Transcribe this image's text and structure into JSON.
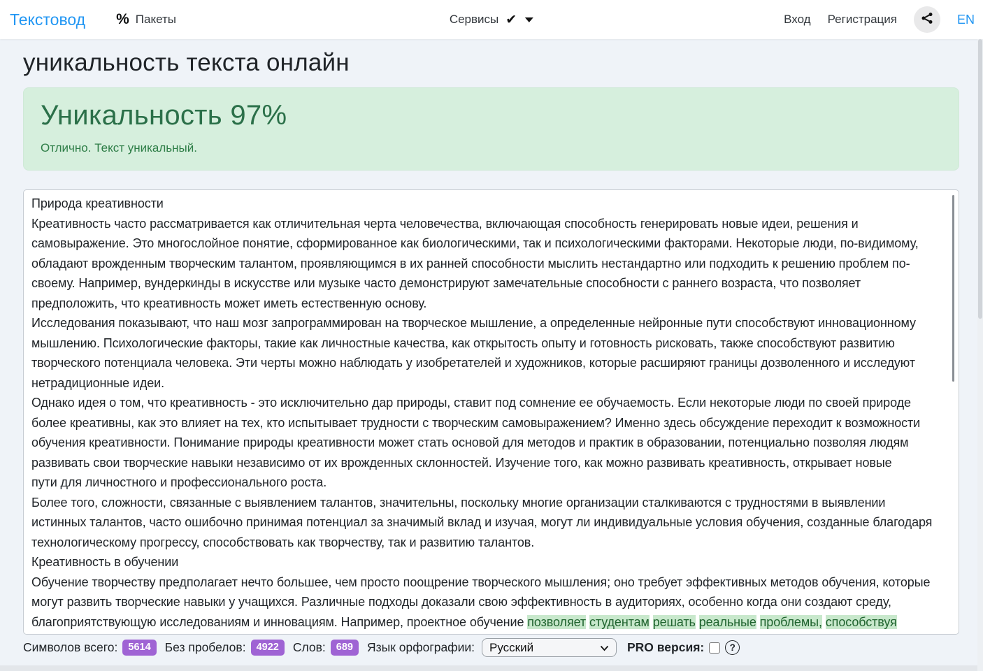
{
  "navbar": {
    "logo": "Текстовод",
    "packages_label": "Пакеты",
    "percent_icon": "%",
    "services_label": "Сервисы",
    "check_icon": "✔",
    "login_label": "Вход",
    "register_label": "Регистрация",
    "lang_label": "EN",
    "accent_color": "#2196f3"
  },
  "page": {
    "title": "уникальность текста онлайн"
  },
  "result": {
    "heading": "Уникальность 97%",
    "subtext": "Отлично. Текст уникальный.",
    "percent": 97,
    "bg_color": "#d6efdd",
    "text_color": "#2b7049"
  },
  "editor": {
    "highlight_bg": "#c8e8cc",
    "lines": [
      [
        {
          "t": "Природа креативности",
          "h": false
        }
      ],
      [
        {
          "t": "Креативность часто рассматривается как отличительная черта человечества, включающая способность генерировать новые идеи, решения и",
          "h": false
        }
      ],
      [
        {
          "t": "самовыражение. Это многослойное понятие, сформированное как биологическими, так и психологическими факторами. Некоторые люди, по-видимому,",
          "h": false
        }
      ],
      [
        {
          "t": "обладают врожденным творческим талантом, проявляющимся в их ранней способности мыслить нестандартно или подходить к решению проблем по-",
          "h": false
        }
      ],
      [
        {
          "t": "своему. Например, вундеркинды в искусстве или музыке часто демонстрируют замечательные способности с раннего возраста, что позволяет",
          "h": false
        }
      ],
      [
        {
          "t": "предположить, что креативность может иметь естественную основу.",
          "h": false
        }
      ],
      [
        {
          "t": "Исследования показывают, что наш мозг запрограммирован на творческое мышление, а определенные нейронные пути способствуют инновационному",
          "h": false
        }
      ],
      [
        {
          "t": "мышлению. Психологические факторы, такие как личностные качества, как открытость опыту и готовность рисковать, также способствуют развитию",
          "h": false
        }
      ],
      [
        {
          "t": "творческого потенциала человека. Эти черты можно наблюдать у изобретателей и художников, которые расширяют границы дозволенного и исследуют",
          "h": false
        }
      ],
      [
        {
          "t": "нетрадиционные идеи.",
          "h": false
        }
      ],
      [
        {
          "t": "Однако идея о том, что креативность - это исключительно дар природы, ставит под сомнение ее обучаемость. Если некоторые люди по своей природе",
          "h": false
        }
      ],
      [
        {
          "t": "более креативны, как это влияет на тех, кто испытывает трудности с творческим самовыражением? Именно здесь обсуждение переходит к возможности",
          "h": false
        }
      ],
      [
        {
          "t": "обучения креативности. Понимание природы креативности может стать основой для методов и практик в образовании, потенциально позволяя людям",
          "h": false
        }
      ],
      [
        {
          "t": "развивать свои творческие навыки независимо от их врожденных склонностей. Изучение того, как можно развивать креативность, открывает новые",
          "h": false
        }
      ],
      [
        {
          "t": "пути для личностного и профессионального роста.",
          "h": false
        }
      ],
      [
        {
          "t": "Более того, сложности, связанные с выявлением талантов, значительны, поскольку многие организации сталкиваются с трудностями в выявлении",
          "h": false
        }
      ],
      [
        {
          "t": "истинных талантов, часто ошибочно принимая потенциал за значимый вклад и изучая, могут ли индивидуальные условия обучения, созданные благодаря",
          "h": false
        }
      ],
      [
        {
          "t": "технологическому прогрессу, способствовать как творчеству, так и развитию талантов.",
          "h": false
        }
      ],
      [
        {
          "t": "Креативность в обучении",
          "h": false
        }
      ],
      [
        {
          "t": "Обучение творчеству предполагает нечто большее, чем просто поощрение творческого мышления; оно требует эффективных методов обучения, которые",
          "h": false
        }
      ],
      [
        {
          "t": "могут развить творческие навыки у учащихся. Различные подходы доказали свою эффективность в аудиториях, особенно когда они создают среду,",
          "h": false
        }
      ],
      [
        {
          "t": "благоприятствующую исследованиям и инновациям. Например, проектное обучение ",
          "h": false
        },
        {
          "t": "позволяет",
          "h": true
        },
        {
          "t": " ",
          "h": false
        },
        {
          "t": "студентам",
          "h": true
        },
        {
          "t": " ",
          "h": false
        },
        {
          "t": "решать",
          "h": true
        },
        {
          "t": " ",
          "h": false
        },
        {
          "t": "реальные",
          "h": true
        },
        {
          "t": " ",
          "h": false
        },
        {
          "t": "проблемы,",
          "h": true
        },
        {
          "t": " ",
          "h": false
        },
        {
          "t": "способствуя",
          "h": true
        }
      ]
    ]
  },
  "statusbar": {
    "chars_total_label": "Символов всего:",
    "chars_total": "5614",
    "no_spaces_label": "Без пробелов:",
    "no_spaces": "4922",
    "words_label": "Слов:",
    "words": "689",
    "lang_label": "Язык орфографии:",
    "lang_value": "Русский",
    "pro_label": "PRO версия:",
    "badge_color": "#9f63d4"
  }
}
